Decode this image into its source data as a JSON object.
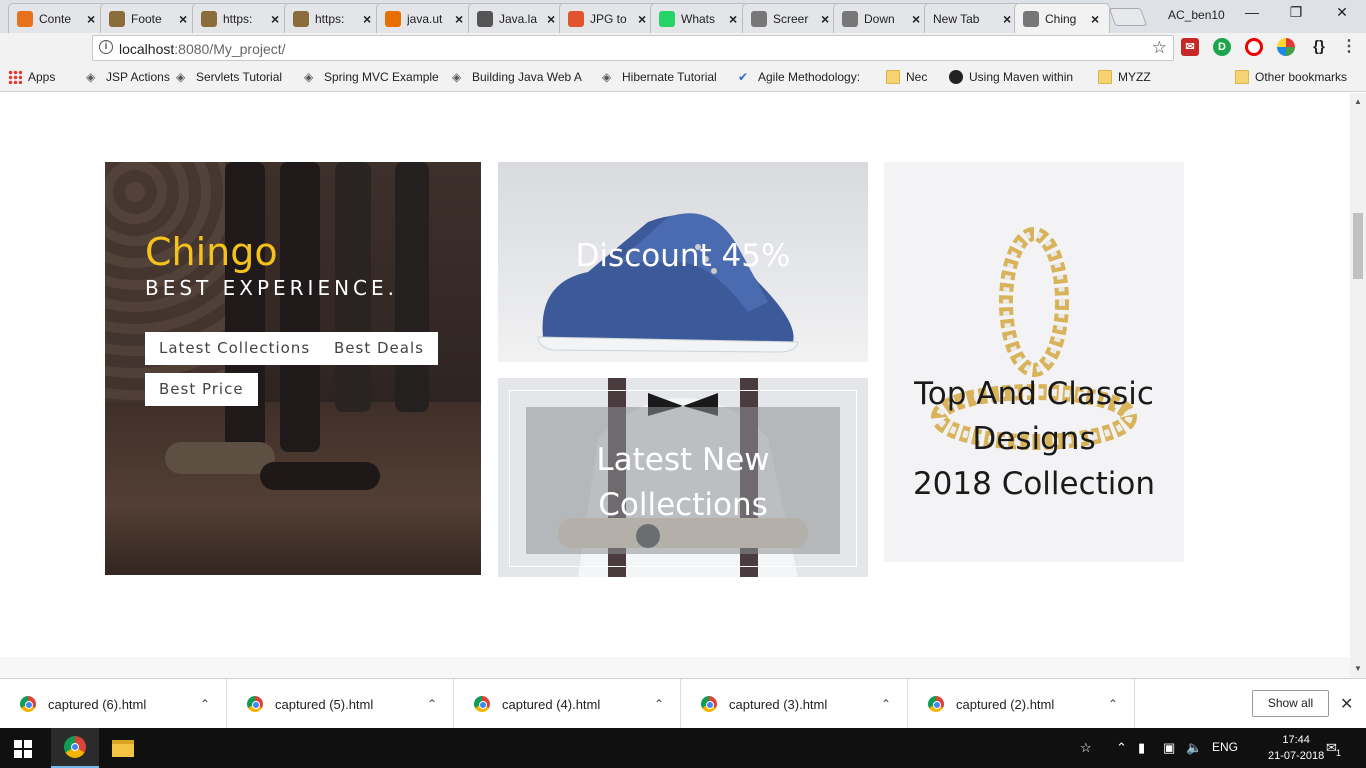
{
  "browser": {
    "tabs": [
      {
        "title": "Conte",
        "icon": "content-tab-icon",
        "color": "#e8711c"
      },
      {
        "title": "Foote",
        "icon": "image-tab-icon",
        "color": "#8a6d3b"
      },
      {
        "title": "https:",
        "icon": "image-tab-icon",
        "color": "#8a6d3b"
      },
      {
        "title": "https:",
        "icon": "image-tab-icon",
        "color": "#8a6d3b"
      },
      {
        "title": "java.ut",
        "icon": "java-tab-icon",
        "color": "#e76f00"
      },
      {
        "title": "Java.la",
        "icon": "diamond-tab-icon",
        "color": "#555555"
      },
      {
        "title": "JPG to",
        "icon": "pdf-tab-icon",
        "color": "#e0542e"
      },
      {
        "title": "Whats",
        "icon": "whatsapp-tab-icon",
        "color": "#25d366"
      },
      {
        "title": "Screer",
        "icon": "document-tab-icon",
        "color": "#777777"
      },
      {
        "title": "Down",
        "icon": "document-tab-icon",
        "color": "#777777"
      },
      {
        "title": "New Tab",
        "icon": "",
        "color": ""
      },
      {
        "title": "Ching",
        "icon": "document-tab-icon",
        "color": "#777777"
      }
    ],
    "profile_name": "AC_ben10",
    "url_host": "localhost",
    "url_path": ":8080/My_project/",
    "bookmarks": [
      {
        "label": "Apps",
        "icon": "apps-grid-icon"
      },
      {
        "label": "JSP Actions",
        "icon": "diamond-icon"
      },
      {
        "label": "Servlets Tutorial",
        "icon": "diamond-icon"
      },
      {
        "label": "Spring MVC Example",
        "icon": "spring-icon"
      },
      {
        "label": "Building Java Web A",
        "icon": "gear-icon"
      },
      {
        "label": "Hibernate Tutorial",
        "icon": "diamond-icon"
      },
      {
        "label": "Agile Methodology:",
        "icon": "check-icon"
      },
      {
        "label": "Nec",
        "icon": "folder-icon"
      },
      {
        "label": "Using Maven within",
        "icon": "eclipse-icon"
      },
      {
        "label": "MYZZ",
        "icon": "folder-icon"
      },
      {
        "label": "Other bookmarks",
        "icon": "folder-icon"
      }
    ]
  },
  "page": {
    "hero": {
      "brand": "Chingo",
      "tagline": "BEST EXPERIENCE.",
      "buttons": [
        "Latest Collections",
        "Best Deals",
        "Best Price"
      ]
    },
    "shoe_panel": {
      "caption": "Discount 45%"
    },
    "collection_panel": {
      "caption_line1": "Latest New",
      "caption_line2": "Collections"
    },
    "jewel_panel": {
      "caption_line1": "Top And Classic",
      "caption_line2": "Designs",
      "caption_line3": "2018 Collection"
    }
  },
  "downloads": {
    "items": [
      "captured (6).html",
      "captured (5).html",
      "captured (4).html",
      "captured (3).html",
      "captured (2).html"
    ],
    "show_all": "Show all"
  },
  "taskbar": {
    "time": "17:44",
    "date": "21-07-2018",
    "lang": "ENG",
    "notifications": "1"
  },
  "colors": {
    "brand_yellow": "#f4c21b",
    "shoe_blue": "#3c5a9a"
  }
}
